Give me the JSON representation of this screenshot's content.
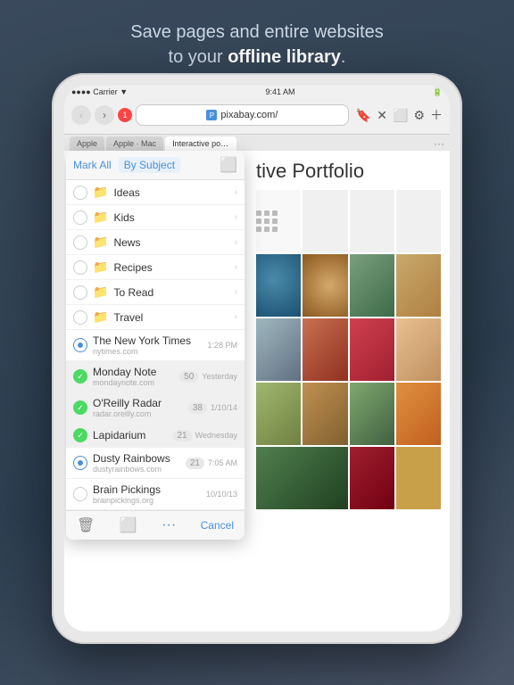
{
  "headline": {
    "line1": "Save pages and entire websites",
    "line2_prefix": "to your ",
    "line2_bold": "offline library",
    "line2_suffix": "."
  },
  "status_bar": {
    "carrier": "●●●● Carrier ▼",
    "time": "9:41 AM",
    "battery": "🔋"
  },
  "address_bar": {
    "url": "pixabay.com/"
  },
  "tabs": [
    {
      "label": "Apple",
      "active": false
    },
    {
      "label": "Apple · Mac",
      "active": false
    },
    {
      "label": "Interactive por...",
      "active": true
    }
  ],
  "site_title": "tive Portfolio",
  "dropdown": {
    "mark_all": "Mark All",
    "by_subject": "By Subject",
    "folders": [
      {
        "name": "Ideas",
        "type": "folder"
      },
      {
        "name": "Kids",
        "type": "folder"
      },
      {
        "name": "News",
        "type": "folder"
      },
      {
        "name": "Recipes",
        "type": "folder"
      },
      {
        "name": "To Read",
        "type": "folder"
      },
      {
        "name": "Travel",
        "type": "folder"
      }
    ],
    "reading_items": [
      {
        "name": "The New York Times",
        "sub": "nytimes.com",
        "time": "1:28 PM",
        "checked": false,
        "dot": true,
        "count": ""
      },
      {
        "name": "Monday Note",
        "sub": "mondaynote.com",
        "time": "Yesterday",
        "checked": true,
        "dot": false,
        "count": "50"
      },
      {
        "name": "O'Reilly Radar",
        "sub": "radar.oreilly.com",
        "time": "1/10/14",
        "checked": true,
        "dot": false,
        "count": "38"
      },
      {
        "name": "Lapidarium",
        "sub": "",
        "time": "Wednesday",
        "checked": true,
        "dot": false,
        "count": "21"
      },
      {
        "name": "Dusty Rainbows",
        "sub": "dustyrainbows.com",
        "time": "7:05 AM",
        "checked": false,
        "dot": true,
        "count": "21"
      },
      {
        "name": "Brain Pickings",
        "sub": "brainpickings.org",
        "time": "10/10/13",
        "checked": false,
        "dot": false,
        "count": ""
      }
    ],
    "cancel": "Cancel"
  }
}
